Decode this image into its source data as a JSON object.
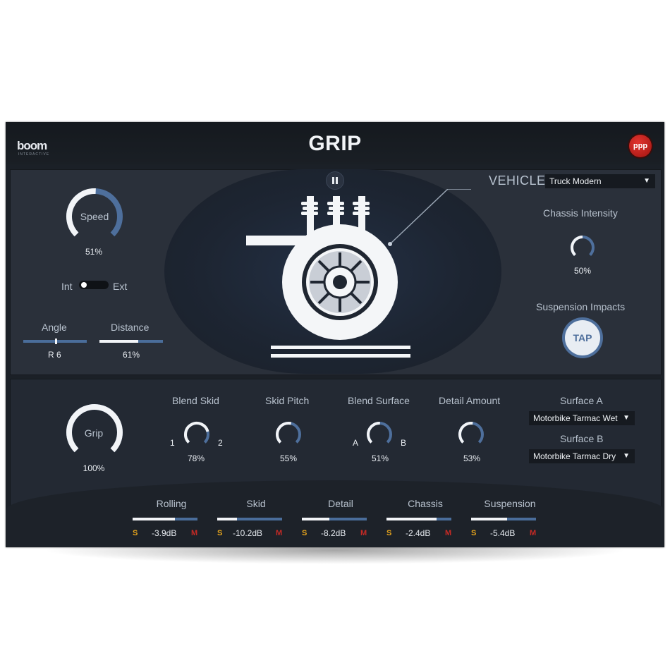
{
  "header": {
    "logo": "boom",
    "logo_sub": "INTERACTIVE",
    "title": "GRIP",
    "badge": "ppp"
  },
  "left": {
    "speed": {
      "label": "Speed",
      "value": "51%",
      "level": 0.51
    },
    "toggle": {
      "left": "Int",
      "right": "Ext",
      "state": "Int"
    },
    "angle": {
      "label": "Angle",
      "value": "R 6",
      "level": 0.52
    },
    "distance": {
      "label": "Distance",
      "value": "61%",
      "level": 0.61
    }
  },
  "right": {
    "vehicle_label": "VEHICLE",
    "vehicle_value": "Truck Modern",
    "chassis": {
      "label": "Chassis Intensity",
      "value": "50%",
      "level": 0.5
    },
    "suspension": {
      "label": "Suspension Impacts",
      "tap": "TAP"
    }
  },
  "bottom": {
    "grip": {
      "label": "Grip",
      "value": "100%",
      "level": 1.0
    },
    "blend_skid": {
      "label": "Blend Skid",
      "value": "78%",
      "level": 0.78,
      "left": "1",
      "right": "2"
    },
    "skid_pitch": {
      "label": "Skid Pitch",
      "value": "55%",
      "level": 0.55
    },
    "blend_surface": {
      "label": "Blend Surface",
      "value": "51%",
      "level": 0.51,
      "left": "A",
      "right": "B"
    },
    "detail_amount": {
      "label": "Detail Amount",
      "value": "53%",
      "level": 0.53
    },
    "surface_a": {
      "label": "Surface A",
      "value": "Motorbike Tarmac Wet"
    },
    "surface_b": {
      "label": "Surface B",
      "value": "Motorbike Tarmac Dry"
    }
  },
  "mixer": [
    {
      "label": "Rolling",
      "db": "-3.9dB",
      "level": 0.65,
      "solo": "S",
      "mute": "M"
    },
    {
      "label": "Skid",
      "db": "-10.2dB",
      "level": 0.3,
      "solo": "S",
      "mute": "M"
    },
    {
      "label": "Detail",
      "db": "-8.2dB",
      "level": 0.42,
      "solo": "S",
      "mute": "M"
    },
    {
      "label": "Chassis",
      "db": "-2.4dB",
      "level": 0.77,
      "solo": "S",
      "mute": "M"
    },
    {
      "label": "Suspension",
      "db": "-5.4dB",
      "level": 0.55,
      "solo": "S",
      "mute": "M"
    }
  ],
  "colors": {
    "accent": "#4e6f9c",
    "track": "#f2f4f7",
    "solo": "#e7a51c",
    "mute": "#c62a25",
    "badge": "#c9231f"
  }
}
